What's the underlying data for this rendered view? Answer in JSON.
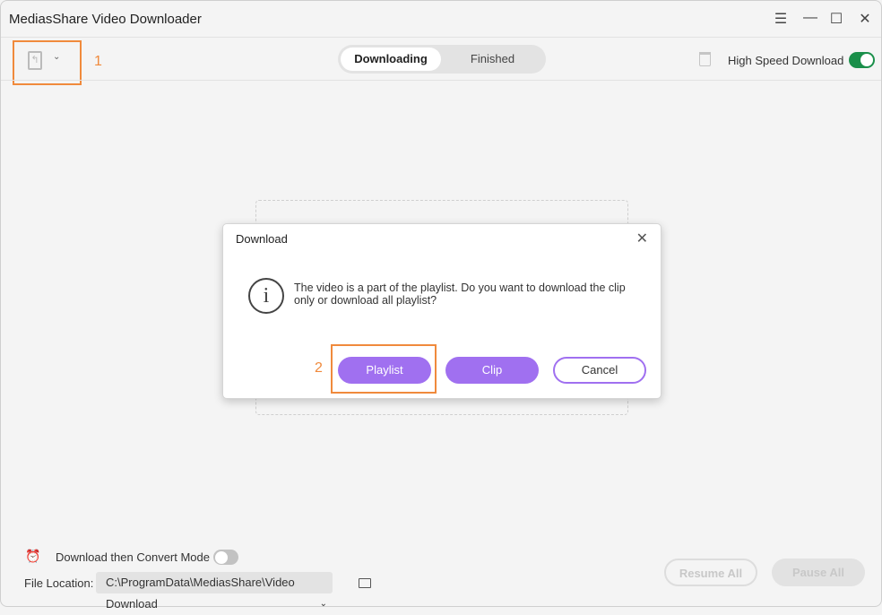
{
  "window": {
    "title": "MediasShare Video Downloader"
  },
  "toolbar": {
    "annotation_1": "1",
    "tabs": [
      {
        "label": "Downloading",
        "active": true
      },
      {
        "label": "Finished",
        "active": false
      }
    ],
    "high_speed_label": "High Speed Download",
    "high_speed_on": true,
    "toggle_color": "#1a8f4a"
  },
  "dialog": {
    "title": "Download",
    "message_line1": "The video is a part of the playlist. Do you want to download the clip",
    "message_line2": "only or download all playlist?",
    "annotation_2": "2",
    "playlist": "Playlist",
    "clip": "Clip",
    "cancel": "Cancel",
    "accent": "#a070f0"
  },
  "footer": {
    "convert_label": "Download then Convert Mode",
    "convert_on": false,
    "file_location_label": "File Location:",
    "file_location_value": "C:\\ProgramData\\MediasShare\\Video Download",
    "resume_all": "Resume All",
    "pause_all": "Pause All"
  }
}
